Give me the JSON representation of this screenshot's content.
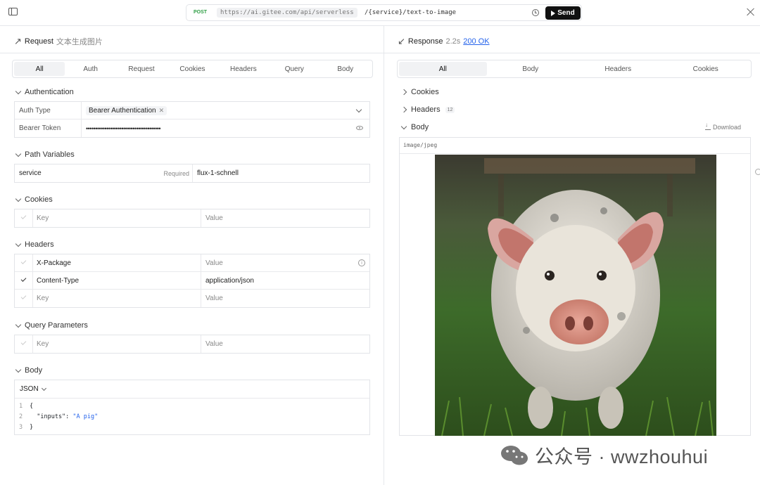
{
  "toolbar": {
    "method": "POST",
    "url_base": "https://ai.gitee.com/api/serverless",
    "url_path": "/{service}/text-to-image",
    "send_label": "Send"
  },
  "request": {
    "title": "Request",
    "subtitle": "文本生成图片",
    "tabs": [
      "All",
      "Auth",
      "Request",
      "Cookies",
      "Headers",
      "Query",
      "Body"
    ],
    "active_tab": "All",
    "auth": {
      "section": "Authentication",
      "type_label": "Auth Type",
      "type_value": "Bearer Authentication",
      "token_label": "Bearer Token",
      "token_value": "••••••••••••••••••••••••••••••••••••••••"
    },
    "path_vars": {
      "section": "Path Variables",
      "name": "service",
      "required": "Required",
      "value": "flux-1-schnell"
    },
    "cookies": {
      "section": "Cookies",
      "key_ph": "Key",
      "value_ph": "Value"
    },
    "headers": {
      "section": "Headers",
      "rows": [
        {
          "key": "X-Package",
          "value": "Value",
          "checked": false
        },
        {
          "key": "Content-Type",
          "value": "application/json",
          "checked": true
        },
        {
          "key": "Key",
          "value": "Value",
          "checked": false
        }
      ]
    },
    "query": {
      "section": "Query Parameters",
      "key_ph": "Key",
      "value_ph": "Value"
    },
    "body": {
      "section": "Body",
      "format": "JSON",
      "lines": [
        "{",
        "  \"inputs\": \"A pig\"",
        "}"
      ]
    }
  },
  "response": {
    "title": "Response",
    "time": "2.2s",
    "status": "200 OK",
    "tabs": [
      "All",
      "Body",
      "Headers",
      "Cookies"
    ],
    "active_tab": "All",
    "cookies_label": "Cookies",
    "headers_label": "Headers",
    "headers_count": "12",
    "body_label": "Body",
    "download_label": "Download",
    "mime": "image/jpeg"
  },
  "watermark": "公众号 · wwzhouhui",
  "colors": {
    "send": "#111111",
    "method": "#2e9e44",
    "link": "#2563eb"
  }
}
